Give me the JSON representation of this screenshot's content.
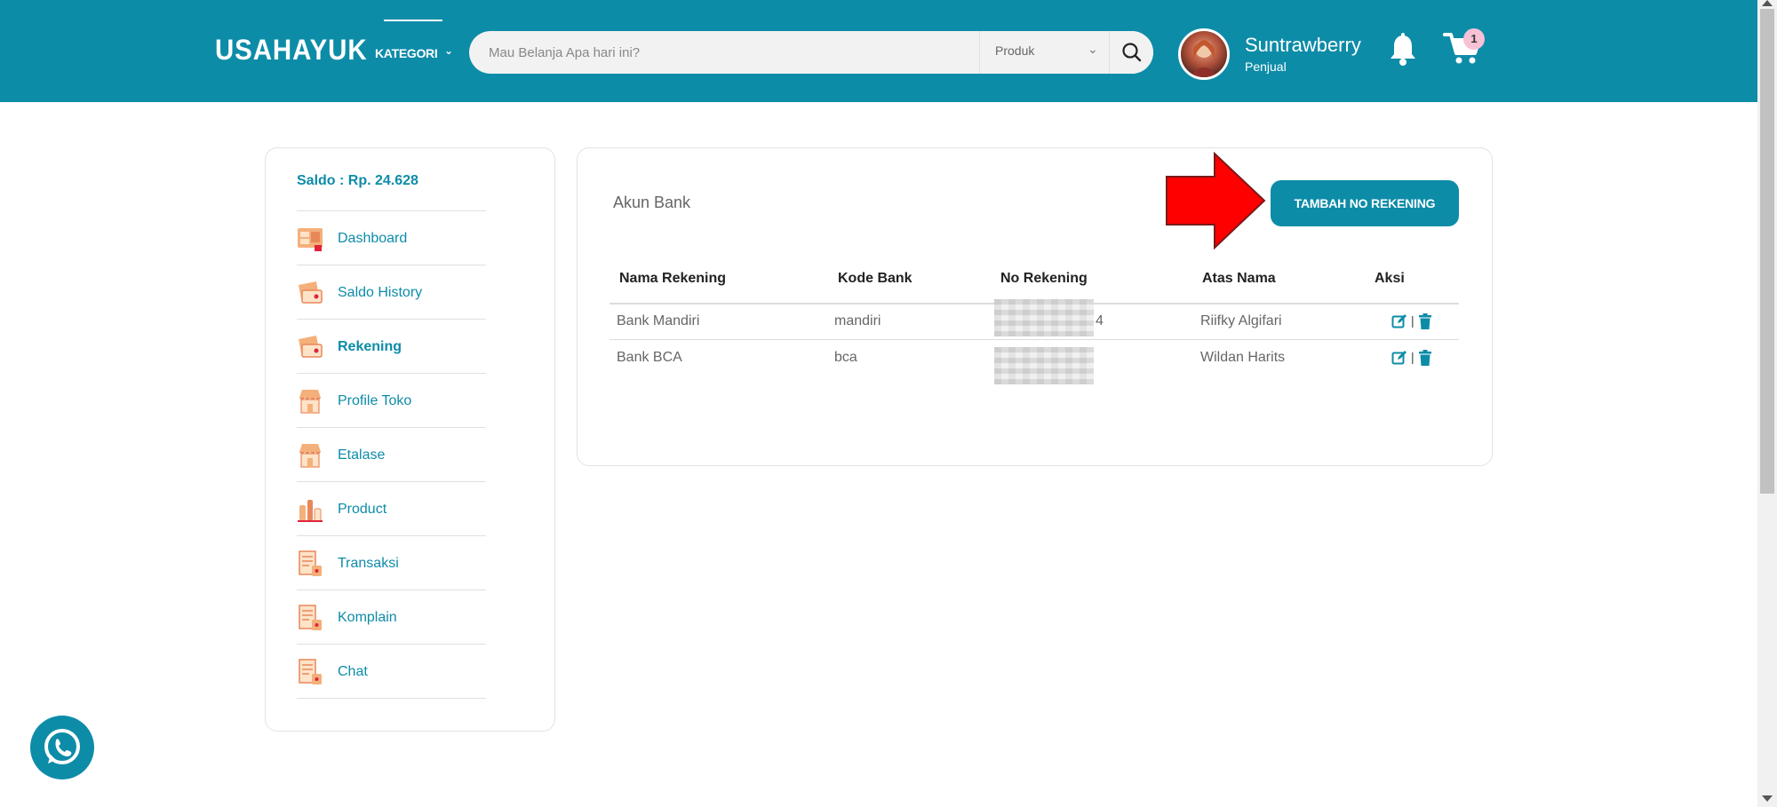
{
  "header": {
    "logo": "USAHAYUK",
    "kategori_label": "KATEGORI",
    "search_placeholder": "Mau Belanja Apa hari ini?",
    "search_type": "Produk",
    "user_name": "Suntrawberry",
    "user_role": "Penjual",
    "cart_count": "1"
  },
  "sidebar": {
    "saldo": "Saldo : Rp. 24.628",
    "items": [
      {
        "label": "Dashboard",
        "icon": "dashboard-icon",
        "active": false
      },
      {
        "label": "Saldo History",
        "icon": "wallet-icon",
        "active": false
      },
      {
        "label": "Rekening",
        "icon": "wallet-icon",
        "active": true
      },
      {
        "label": "Profile Toko",
        "icon": "store-icon",
        "active": false
      },
      {
        "label": "Etalase",
        "icon": "store-icon",
        "active": false
      },
      {
        "label": "Product",
        "icon": "product-icon",
        "active": false
      },
      {
        "label": "Transaksi",
        "icon": "document-icon",
        "active": false
      },
      {
        "label": "Komplain",
        "icon": "document-icon",
        "active": false
      },
      {
        "label": "Chat",
        "icon": "document-icon",
        "active": false
      }
    ]
  },
  "main": {
    "title": "Akun Bank",
    "add_button": "TAMBAH NO REKENING",
    "columns": [
      "Nama Rekening",
      "Kode Bank",
      "No Rekening",
      "Atas Nama",
      "Aksi"
    ],
    "rows": [
      {
        "nama": "Bank Mandiri",
        "kode": "mandiri",
        "no_suffix": "4",
        "atas_nama": "Riifky Algifari"
      },
      {
        "nama": "Bank BCA",
        "kode": "bca",
        "no_suffix": "",
        "atas_nama": "Wildan Harits"
      }
    ]
  },
  "colors": {
    "primary": "#0d8ca8",
    "arrow": "#ff0000",
    "badge": "#f7c1d6"
  }
}
